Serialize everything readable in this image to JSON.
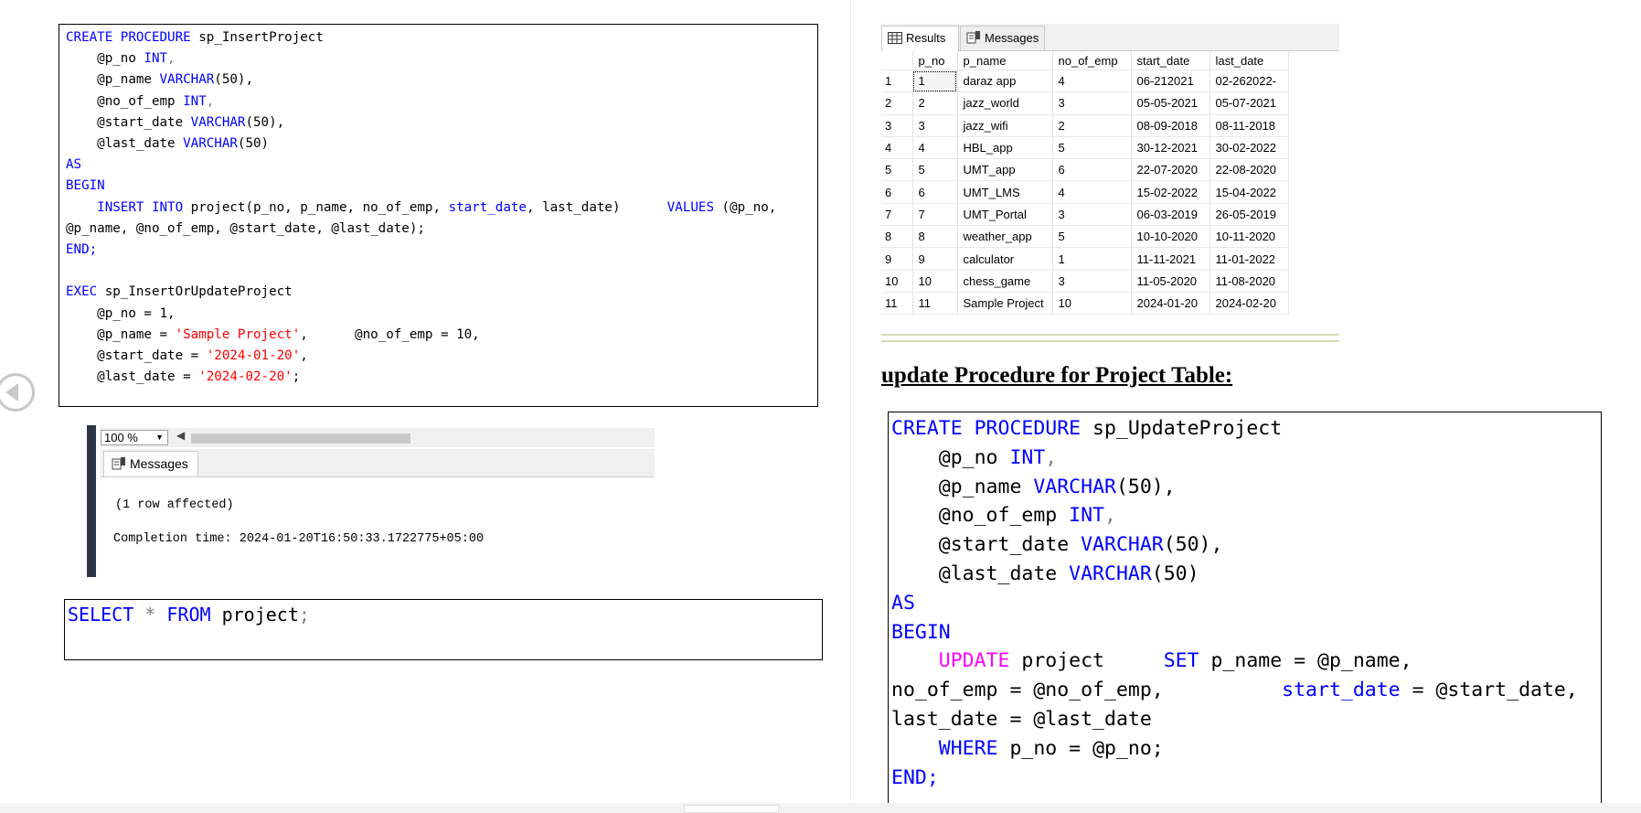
{
  "insert_code": {
    "l1_kw": "CREATE PROCEDURE",
    "l1_name": " sp_InsertProject",
    "l2_param": "    @p_no ",
    "l2_type": "INT",
    "l2_punct": ",",
    "l3_param": "    @p_name ",
    "l3_type": "VARCHAR",
    "l3_rest": "(50),",
    "l4_param": "    @no_of_emp ",
    "l4_type": "INT",
    "l4_punct": ",",
    "l5_param": "    @start_date ",
    "l5_type": "VARCHAR",
    "l5_rest": "(50),",
    "l6_param": "    @last_date ",
    "l6_type": "VARCHAR",
    "l6_rest": "(50)",
    "l7": "AS",
    "l8": "BEGIN",
    "l9_indent": "    ",
    "l9_kw": "INSERT INTO",
    "l9_a": " project(p_no, p_name, no_of_emp, ",
    "l9_start": "start_date",
    "l9_b": ", last_date)      ",
    "l9_values": "VALUES",
    "l9_c": " (@p_no,",
    "l10": "@p_name, @no_of_emp, @start_date, @last_date);",
    "l11": "END;",
    "l13_kw": "EXEC",
    "l13_name": " sp_InsertOrUpdateProject",
    "l14": "    @p_no = 1,",
    "l15_a": "    @p_name = ",
    "l15_str": "'Sample Project'",
    "l15_b": ",      @no_of_emp = 10,",
    "l16_a": "    @start_date = ",
    "l16_str": "'2024-01-20'",
    "l16_b": ",",
    "l17_a": "    @last_date = ",
    "l17_str": "'2024-02-20'",
    "l17_b": ";"
  },
  "insert_result": {
    "zoom": "100 %",
    "tab_icon": "messages-icon",
    "tab_label": "Messages",
    "rows_affected": "(1 row affected)",
    "completion": "Completion time: 2024-01-20T16:50:33.1722775+05:00"
  },
  "select_code": {
    "kw1": "SELECT",
    "star": " * ",
    "kw2": "FROM",
    "rest": " project",
    "semi": ";"
  },
  "grid": {
    "tab_results": "Results",
    "tab_messages": "Messages",
    "columns": [
      "p_no",
      "p_name",
      "no_of_emp",
      "start_date",
      "last_date"
    ],
    "rows": [
      [
        "1",
        "1",
        "daraz app",
        "4",
        "06-212021",
        "02-262022-"
      ],
      [
        "2",
        "2",
        "jazz_world",
        "3",
        "05-05-2021",
        "05-07-2021"
      ],
      [
        "3",
        "3",
        "jazz_wifi",
        "2",
        "08-09-2018",
        "08-11-2018"
      ],
      [
        "4",
        "4",
        "HBL_app",
        "5",
        "30-12-2021",
        "30-02-2022"
      ],
      [
        "5",
        "5",
        "UMT_app",
        "6",
        "22-07-2020",
        "22-08-2020"
      ],
      [
        "6",
        "6",
        "UMT_LMS",
        "4",
        "15-02-2022",
        "15-04-2022"
      ],
      [
        "7",
        "7",
        "UMT_Portal",
        "3",
        "06-03-2019",
        "26-05-2019"
      ],
      [
        "8",
        "8",
        "weather_app",
        "5",
        "10-10-2020",
        "10-11-2020"
      ],
      [
        "9",
        "9",
        "calculator",
        "1",
        "11-11-2021",
        "11-01-2022"
      ],
      [
        "10",
        "10",
        "chess_game",
        "3",
        "11-05-2020",
        "11-08-2020"
      ],
      [
        "11",
        "11",
        "Sample Project",
        "10",
        "2024-01-20",
        "2024-02-20"
      ]
    ]
  },
  "heading": "update Procedure for Project Table:",
  "update_code": {
    "l1_kw": "CREATE PROCEDURE",
    "l1_name": " sp_UpdateProject",
    "l2_param": "    @p_no ",
    "l2_type": "INT",
    "l2_punct": ",",
    "l3_param": "    @p_name ",
    "l3_type": "VARCHAR",
    "l3_rest": "(50),",
    "l4_param": "    @no_of_emp ",
    "l4_type": "INT",
    "l4_punct": ",",
    "l5_param": "    @start_date ",
    "l5_type": "VARCHAR",
    "l5_rest": "(50),",
    "l6_param": "    @last_date ",
    "l6_type": "VARCHAR",
    "l6_rest": "(50)",
    "l7": "AS",
    "l8": "BEGIN",
    "l9_indent": "    ",
    "l9_update": "UPDATE",
    "l9_a": " project     ",
    "l9_set": "SET",
    "l9_b": " p_name = @p_name,",
    "l10_a": "no_of_emp = @no_of_emp,",
    "l10_gap": "          ",
    "l10_start": "start_date",
    "l10_b": " = @start_date,",
    "l11": "last_date = @last_date",
    "l12_indent": "    ",
    "l12_kw": "WHERE",
    "l12_rest": " p_no = @p_no;",
    "l13": "END;"
  },
  "colors": {
    "keyword": "#0000ff",
    "string": "#ff0000",
    "update_keyword": "#ff00ff",
    "operator": "#808080"
  }
}
